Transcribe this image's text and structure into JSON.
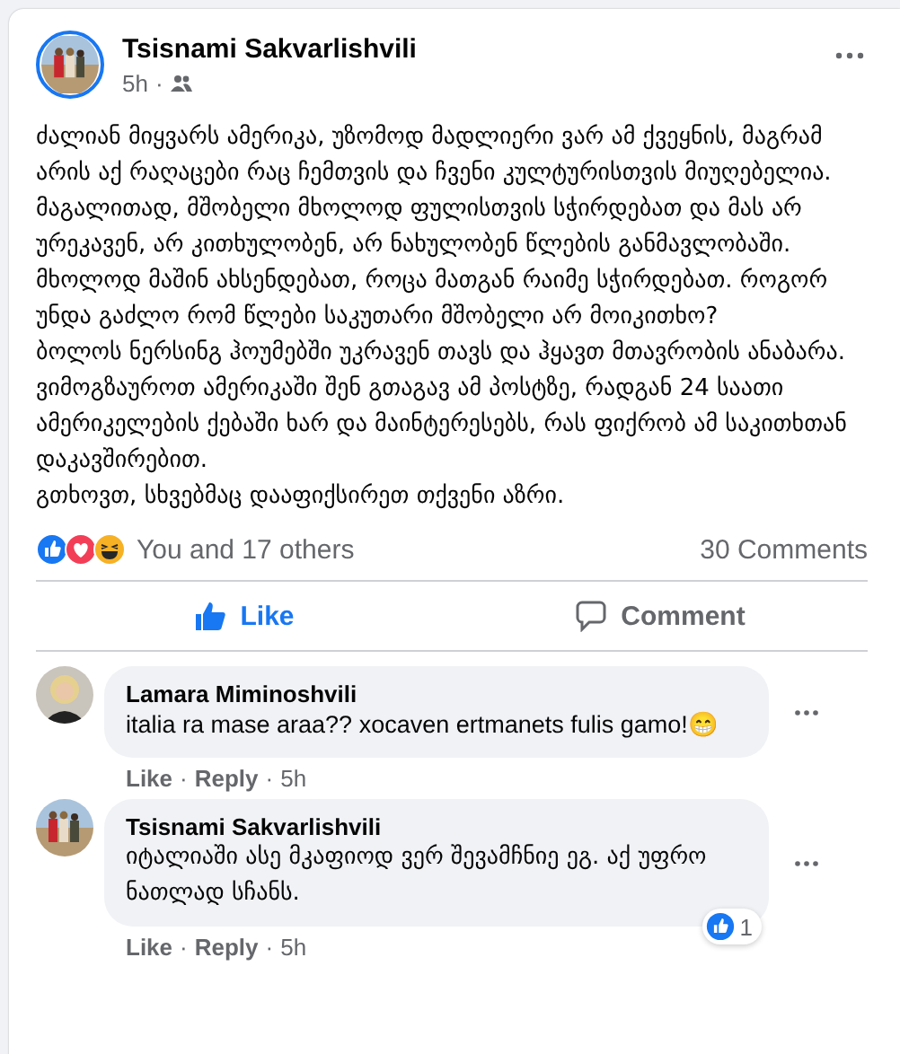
{
  "post": {
    "author": "Tsisnami Sakvarlishvili",
    "time": "5h",
    "audience_separator": "·",
    "paragraphs": [
      "ძალიან მიყვარს ამერიკა, უზომოდ მადლიერი ვარ ამ ქვეყნის, მაგრამ არის აქ რაღაცები რაც ჩემთვის და ჩვენი კულტურისთვის მიუღებელია.",
      "მაგალითად, მშობელი მხოლოდ ფულისთვის სჭირდებათ და მას არ ურეკავენ, არ კითხულობენ, არ ნახულობენ წლების განმავლობაში. მხოლოდ მაშინ ახსენდებათ, როცა მათგან რაიმე სჭირდებათ. როგორ უნდა გაძლო რომ წლები საკუთარი მშობელი არ მოიკითხო?",
      "ბოლოს ნერსინგ ჰოუმებში უკრავენ თავს და ჰყავთ მთავრობის ანაბარა.",
      "ვიმოგზაუროთ ამერიკაში შენ გთაგავ ამ პოსტზე, რადგან 24 საათი ამერიკელების ქებაში ხარ და მაინტერესებს, რას ფიქრობ ამ საკითხთან დაკავშირებით.",
      "გთხოვთ, სხვებმაც დააფიქსირეთ თქვენი აზრი."
    ],
    "reactions_summary": "You and 17 others",
    "comments_count": "30 Comments",
    "actions": [
      {
        "kind": "like",
        "label": "Like",
        "active": true
      },
      {
        "kind": "comment",
        "label": "Comment",
        "active": false
      }
    ]
  },
  "comments": [
    {
      "author": "Lamara Miminoshvili",
      "text": "italia ra mase araa?? xocaven ertmanets fulis gamo!😁",
      "like": "Like",
      "separator": "·",
      "reply": "Reply",
      "time": "5h"
    },
    {
      "author": "Tsisnami Sakvarlishvili",
      "text": "იტალიაში ასე მკაფიოდ ვერ შევამჩნიე ეგ. აქ უფრო ნათლად სჩანს.",
      "like": "Like",
      "separator": "·",
      "reply": "Reply",
      "time": "5h",
      "reaction_count": "1"
    }
  ]
}
